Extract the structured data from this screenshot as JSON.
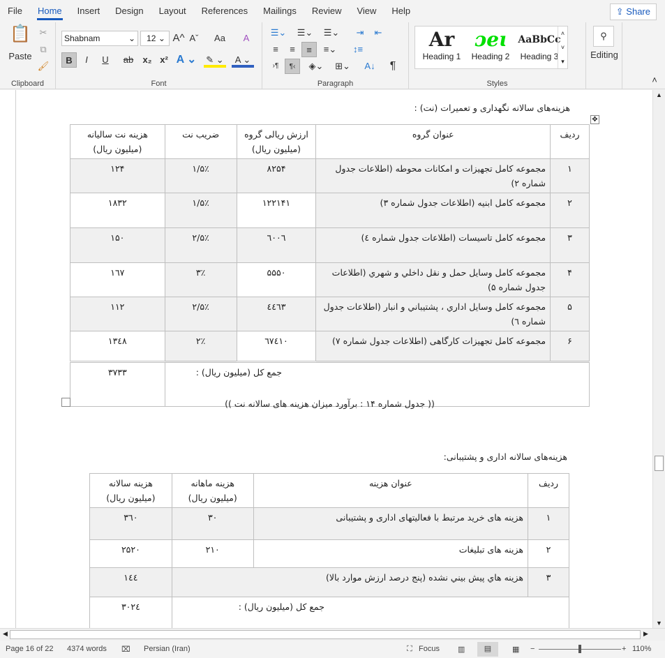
{
  "menu": {
    "tabs": [
      "File",
      "Home",
      "Insert",
      "Design",
      "Layout",
      "References",
      "Mailings",
      "Review",
      "View",
      "Help"
    ],
    "active": "Home",
    "share": "Share"
  },
  "ribbon": {
    "clipboard": {
      "paste": "Paste",
      "label": "Clipboard"
    },
    "font": {
      "name": "Shabnam",
      "size": "12",
      "label": "Font",
      "bold": "B",
      "italic": "I",
      "underline": "U",
      "strike": "ab",
      "subscript": "x₂",
      "superscript": "x²",
      "grow": "A^",
      "shrink": "Aˇ",
      "case": "Aa"
    },
    "paragraph": {
      "label": "Paragraph",
      "pilcrow": "¶"
    },
    "styles": {
      "label": "Styles",
      "items": [
        {
          "preview": "Ar",
          "name": "Heading 1"
        },
        {
          "preview": "ɔeɩ",
          "name": "Heading 2",
          "color": "#00e000"
        },
        {
          "preview": "AaBbCc",
          "name": "Heading 3"
        }
      ]
    },
    "editing": {
      "label": "Editing"
    }
  },
  "doc": {
    "heading1": "هزینه‌های سالانه نگهداری و تعمیرات (نت) :",
    "table1": {
      "headers": [
        "ردیف",
        "عنوان گروه",
        "ارزش ریالی گروه (میلیون ریال)",
        "ضریب نت",
        "هزینه نت سالیانه (میلیون ریال)"
      ],
      "rows": [
        [
          "۱",
          "مجموعه کامل تجهیزات و امکانات محوطه (اطلاعات جدول شماره ۲)",
          "۸۲۵۴",
          "۱/۵٪",
          "۱۲۴"
        ],
        [
          "۲",
          "مجموعه کامل ابنیه (اطلاعات جدول شماره ۳)",
          "۱۲۲۱۴۱",
          "۱/۵٪",
          "۱۸۳۲"
        ],
        [
          "۳",
          "مجموعه کامل تاسیسات (اطلاعات جدول شماره ٤)",
          "٦۰۰٦",
          "۲/۵٪",
          "۱۵۰"
        ],
        [
          "۴",
          "مجموعه کامل وسایل حمل و نقل داخلي و شهري (اطلاعات جدول شماره ۵)",
          "۵۵۵۰",
          "۳٪",
          "۱٦۷"
        ],
        [
          "۵",
          "مجموعه کامل وسایل اداري ، پشتيباني و انبار (اطلاعات جدول شماره ٦)",
          "٤٤٦۳",
          "۲/۵٪",
          "۱۱۲"
        ],
        [
          "۶",
          "مجموعه کامل تجهیزات کارگاهی (اطلاعات جدول شماره ۷)",
          "٦۷٤۱۰",
          "۲٪",
          "۱۳٤۸"
        ]
      ],
      "total_label": "جمع کل (میلیون ریال) :",
      "total": "۳۷۳۳"
    },
    "caption1": "(( جدول شماره ۱۴ : برآورد میزان هزینه های سالانه نت ))",
    "heading2": "هزینه‌های سالانه اداری و پشتیبانی:",
    "table2": {
      "headers": [
        "ردیف",
        "عنوان هزینه",
        "هزینه ماهانه (میلیون ریال)",
        "هزینه سالانه (میلیون ریال)"
      ],
      "rows": [
        [
          "۱",
          "هزینه های خرید مرتبط با فعالیتهای اداری و پشتیبانی",
          "۳۰",
          "۳٦۰"
        ],
        [
          "۲",
          "هزینه های تبلیغات",
          "۲۱۰",
          "۲۵۲۰"
        ],
        [
          "۳",
          "هزينه هاي پيش بيني نشده (پنج درصد ارزش موارد بالا)",
          "",
          "۱٤٤"
        ]
      ],
      "total_label": "جمع کل (میلیون ریال) :",
      "total": "۳۰۲٤"
    }
  },
  "status": {
    "page": "Page 16 of 22",
    "words": "4374 words",
    "language": "Persian (Iran)",
    "focus": "Focus",
    "zoom": "110%",
    "zoom_percent": 110
  }
}
